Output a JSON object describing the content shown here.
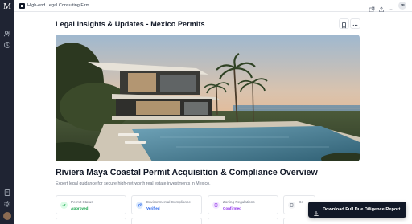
{
  "app": {
    "logo_letter": "M",
    "firm_name": "High-end Legal Consulting Firm",
    "user_initials": "JB"
  },
  "page": {
    "title": "Legal Insights & Updates - Mexico Permits"
  },
  "hero": {
    "image_alt": "Modern coastal villa with infinity pool overlooking the sea at sunset"
  },
  "report": {
    "title": "Riviera Maya Coastal Permit Acquisition & Compliance Overview",
    "subtitle": "Expert legal guidance for secure high-net-worth real estate investments in Mexico."
  },
  "stats": [
    {
      "label": "Permit Status",
      "value": "Approved",
      "icon": "check-icon",
      "color": "#16a34a",
      "bg": "#dcfce7"
    },
    {
      "label": "Environmental Compliance",
      "value": "Verified",
      "icon": "leaf-icon",
      "color": "#2563eb",
      "bg": "#dbeafe"
    },
    {
      "label": "Zoning Regulations",
      "value": "Confirmed",
      "icon": "document-icon",
      "color": "#9333ea",
      "bg": "#f3e8ff"
    },
    {
      "label": "Do",
      "value": "",
      "icon": "document-icon",
      "color": "#6b7280",
      "bg": "#f3f4f6"
    }
  ],
  "download_button": {
    "label": "Download Full Due Diligence Report",
    "icon": "download-icon"
  },
  "colors": {
    "rail": "#1f2433",
    "accent": "#111827"
  }
}
